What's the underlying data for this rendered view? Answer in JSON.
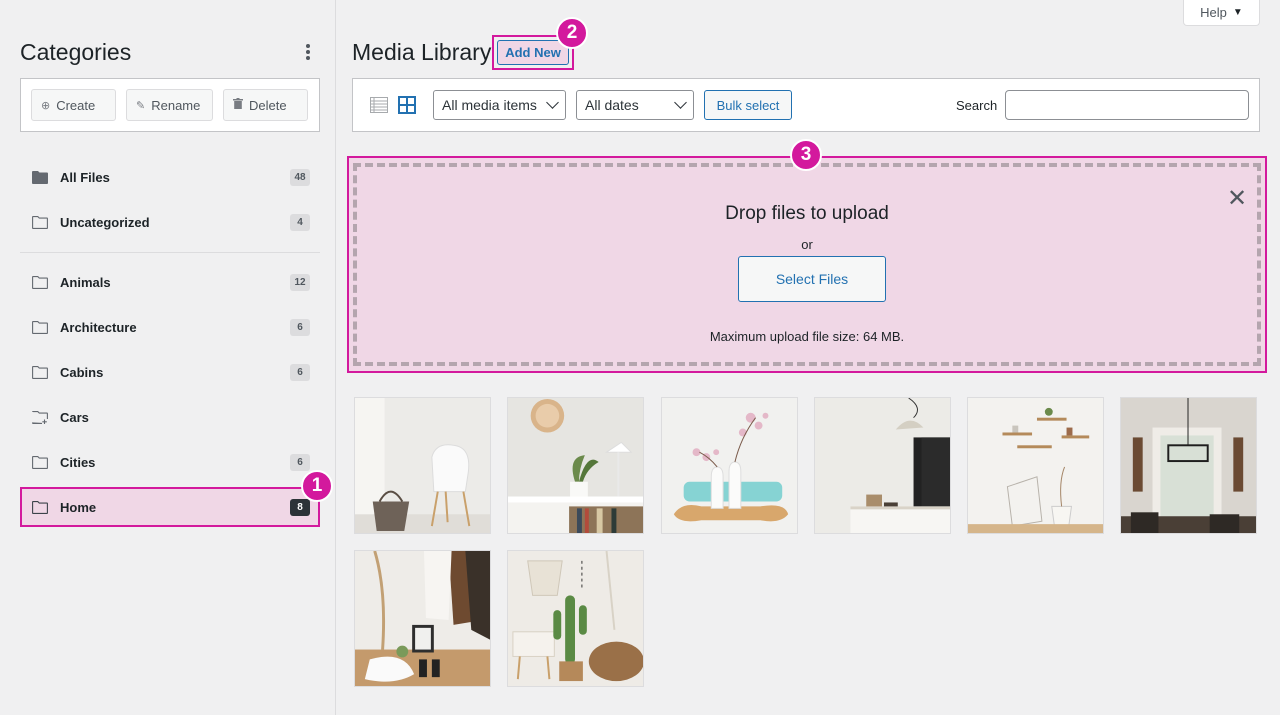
{
  "help": {
    "label": "Help"
  },
  "sidebar": {
    "title": "Categories",
    "toolbar": {
      "create": "Create",
      "rename": "Rename",
      "delete": "Delete"
    },
    "folders_top": [
      {
        "label": "All Files",
        "count": "48"
      },
      {
        "label": "Uncategorized",
        "count": "4"
      }
    ],
    "folders": [
      {
        "label": "Animals",
        "count": "12"
      },
      {
        "label": "Architecture",
        "count": "6"
      },
      {
        "label": "Cabins",
        "count": "6"
      },
      {
        "label": "Cars",
        "count": ""
      },
      {
        "label": "Cities",
        "count": "6"
      },
      {
        "label": "Home",
        "count": "8",
        "active": true
      }
    ]
  },
  "main": {
    "title": "Media Library",
    "add_new": "Add New",
    "toolbar": {
      "media_filter": "All media items",
      "date_filter": "All dates",
      "bulk_select": "Bulk select",
      "search_label": "Search",
      "search_value": ""
    },
    "dropzone": {
      "title": "Drop files to upload",
      "or": "or",
      "select_files": "Select Files",
      "max_size": "Maximum upload file size: 64 MB."
    }
  },
  "annotations": {
    "badge1": "1",
    "badge2": "2",
    "badge3": "3"
  },
  "colors": {
    "accent": "#d3199d",
    "highlight": "#f0d7e6",
    "wp_blue": "#2271b1"
  }
}
